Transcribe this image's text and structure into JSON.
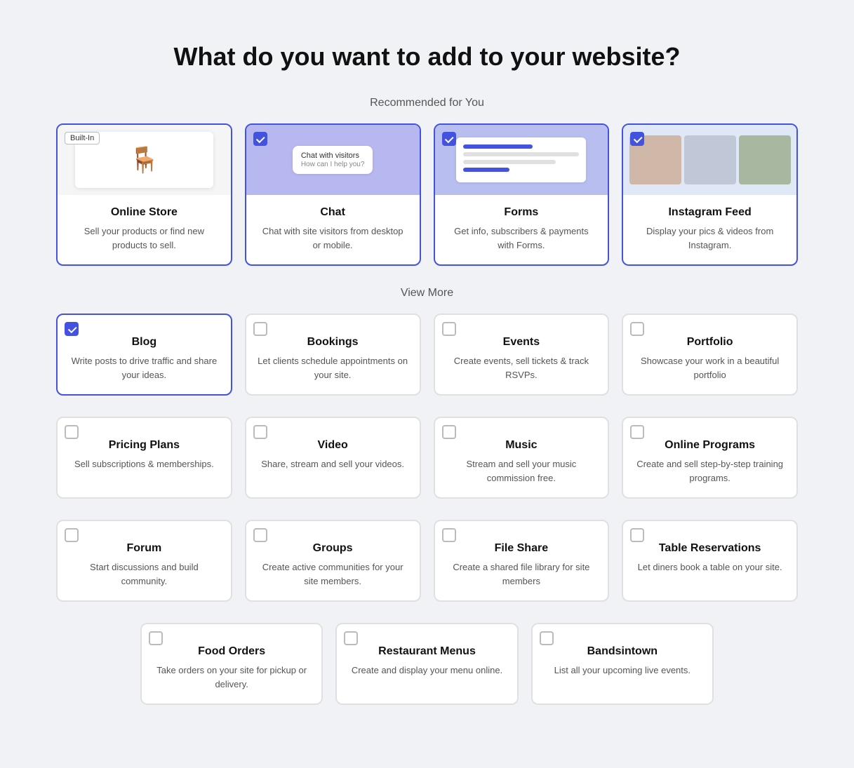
{
  "page": {
    "title": "What do you want to add to your website?",
    "recommended_label": "Recommended for You",
    "view_more_label": "View More"
  },
  "recommended": [
    {
      "id": "online-store",
      "title": "Online Store",
      "desc": "Sell your products or find new products to sell.",
      "selected": false,
      "built_in": true,
      "has_image": true,
      "image_type": "store"
    },
    {
      "id": "chat",
      "title": "Chat",
      "desc": "Chat with site visitors from desktop or mobile.",
      "selected": true,
      "built_in": false,
      "has_image": true,
      "image_type": "chat"
    },
    {
      "id": "forms",
      "title": "Forms",
      "desc": "Get info, subscribers & payments with Forms.",
      "selected": true,
      "built_in": false,
      "has_image": true,
      "image_type": "forms"
    },
    {
      "id": "instagram-feed",
      "title": "Instagram Feed",
      "desc": "Display your pics & videos from Instagram.",
      "selected": true,
      "built_in": false,
      "has_image": true,
      "image_type": "instagram"
    }
  ],
  "view_more": [
    {
      "id": "blog",
      "title": "Blog",
      "desc": "Write posts to drive traffic and share your ideas.",
      "selected": true
    },
    {
      "id": "bookings",
      "title": "Bookings",
      "desc": "Let clients schedule appointments on your site.",
      "selected": false
    },
    {
      "id": "events",
      "title": "Events",
      "desc": "Create events, sell tickets & track RSVPs.",
      "selected": false
    },
    {
      "id": "portfolio",
      "title": "Portfolio",
      "desc": "Showcase your work in a beautiful portfolio",
      "selected": false
    },
    {
      "id": "pricing-plans",
      "title": "Pricing Plans",
      "desc": "Sell subscriptions & memberships.",
      "selected": false
    },
    {
      "id": "video",
      "title": "Video",
      "desc": "Share, stream and sell your videos.",
      "selected": false
    },
    {
      "id": "music",
      "title": "Music",
      "desc": "Stream and sell your music commission free.",
      "selected": false
    },
    {
      "id": "online-programs",
      "title": "Online Programs",
      "desc": "Create and sell step-by-step training programs.",
      "selected": false
    },
    {
      "id": "forum",
      "title": "Forum",
      "desc": "Start discussions and build community.",
      "selected": false
    },
    {
      "id": "groups",
      "title": "Groups",
      "desc": "Create active communities for your site members.",
      "selected": false
    },
    {
      "id": "file-share",
      "title": "File Share",
      "desc": "Create a shared file library for site members",
      "selected": false
    },
    {
      "id": "table-reservations",
      "title": "Table Reservations",
      "desc": "Let diners book a table on your site.",
      "selected": false
    }
  ],
  "bottom_row": [
    {
      "id": "food-orders",
      "title": "Food Orders",
      "desc": "Take orders on your site for pickup or delivery.",
      "selected": false
    },
    {
      "id": "restaurant-menus",
      "title": "Restaurant Menus",
      "desc": "Create and display your menu online.",
      "selected": false
    },
    {
      "id": "bandsintown",
      "title": "Bandsintown",
      "desc": "List all your upcoming live events.",
      "selected": false
    }
  ],
  "labels": {
    "built_in": "Built-In"
  }
}
